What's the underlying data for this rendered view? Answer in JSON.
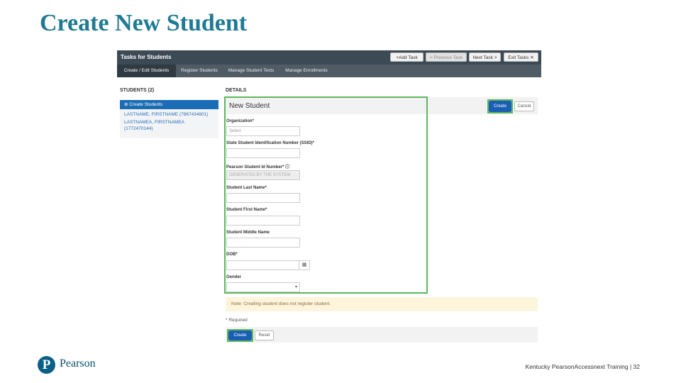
{
  "slide": {
    "title": "Create New Student"
  },
  "app": {
    "topbar_title": "Tasks for Students",
    "buttons": {
      "add_task": "+Add Task",
      "previous_task": "< Previous Task",
      "next_task": "Next Task >",
      "exit_tasks": "Exit Tasks ✕"
    },
    "tabs": [
      "Create / Edit Students",
      "Register Students",
      "Manage Student Tests",
      "Manage Enrollments"
    ],
    "active_tab": 0
  },
  "sidebar": {
    "heading": "STUDENTS (2)",
    "create_label": "Create Students",
    "students": [
      "LASTNAME, FIRSTNAME (7867434801)",
      "LASTNAMEA, FIRSTNAMEA",
      "(1772470144)"
    ]
  },
  "details": {
    "heading": "DETAILS",
    "panel_title": "New Student",
    "create_label": "Create",
    "cancel_label": "Cancel",
    "fields": {
      "organization": {
        "label": "Organization*",
        "placeholder": "Select"
      },
      "ssid": {
        "label": "State Student Identification Number (SSID)*"
      },
      "pearson_id": {
        "label": "Pearson Student Id Number*",
        "value": "GENERATED BY THE SYSTEM"
      },
      "last_name": {
        "label": "Student Last Name*"
      },
      "first_name": {
        "label": "Student First Name*"
      },
      "middle_name": {
        "label": "Student Middle Name"
      },
      "dob": {
        "label": "DOB*"
      },
      "gender": {
        "label": "Gender"
      }
    },
    "note": "Note: Creating student does not register student.",
    "required_note": "* Required",
    "reset_label": "Reset"
  },
  "footer": {
    "logo_text": "Pearson",
    "text": "Kentucky PearsonAccessnext Training | 32"
  },
  "colors": {
    "title": "#1f7a93",
    "accent_green": "#5cb85c",
    "primary_blue": "#1a5fb4"
  }
}
